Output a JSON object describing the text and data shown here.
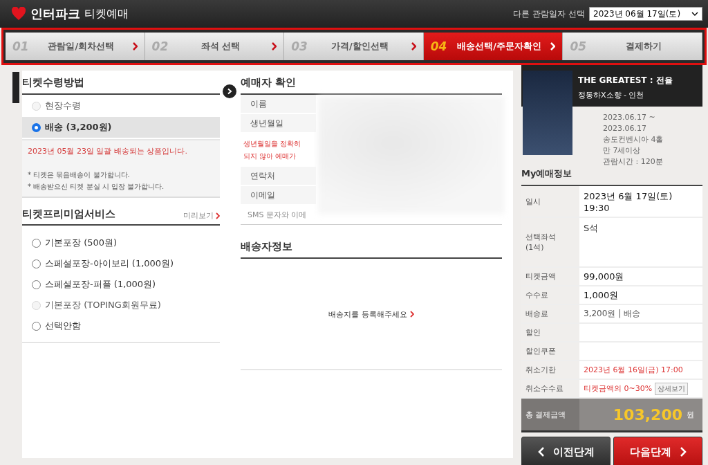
{
  "header": {
    "brand": "인터파크",
    "title": "티켓예매",
    "date_label": "다른 관람일자 선택",
    "date_select": "2023년 06월 17일(토)"
  },
  "steps": [
    {
      "number": "01",
      "label": "관람일/회차선택",
      "selected": false
    },
    {
      "number": "02",
      "label": "좌석 선택",
      "selected": false
    },
    {
      "number": "03",
      "label": "가격/할인선택",
      "selected": false
    },
    {
      "number": "04",
      "label": "배송선택/주문자확인",
      "selected": true
    },
    {
      "number": "05",
      "label": "결제하기",
      "selected": false
    }
  ],
  "receipt": {
    "title": "티켓수령방법",
    "options": [
      {
        "label": "현장수령",
        "selected": false,
        "disabled": true
      },
      {
        "label": "배송 (3,200원)",
        "selected": true,
        "disabled": false
      }
    ],
    "notice": "2023년 05월 23일 일괄 배송되는 상품입니다.",
    "notes": [
      "* 티켓은 묶음배송이 불가합니다.",
      "* 배송받으신 티켓 분실 시 입장 불가합니다."
    ]
  },
  "premium": {
    "title": "티켓프리미엄서비스",
    "preview_link": "미리보기",
    "options": [
      {
        "label": "기본포장 (500원)",
        "selected": false,
        "disabled": false
      },
      {
        "label": "스페셜포장-아이보리 (1,000원)",
        "selected": false,
        "disabled": false
      },
      {
        "label": "스페셜포장-퍼플 (1,000원)",
        "selected": false,
        "disabled": false
      },
      {
        "label": "기본포장 (TOPING회원무료)",
        "selected": false,
        "disabled": true
      },
      {
        "label": "선택안함",
        "selected": false,
        "disabled": false
      }
    ]
  },
  "buyer": {
    "title": "예매자 확인",
    "rows": [
      {
        "kind": "field",
        "label": "이름"
      },
      {
        "kind": "field",
        "label": "생년월일"
      },
      {
        "kind": "warning",
        "lines": [
          "생년월일을 정확히",
          "되지 않아 예매가"
        ]
      },
      {
        "kind": "field",
        "label": "연락처"
      },
      {
        "kind": "field",
        "label": "이메일"
      },
      {
        "kind": "note",
        "label": "SMS 문자와 이메"
      }
    ]
  },
  "delivery": {
    "title": "배송자정보",
    "register_link": "배송지를 등록해주세요"
  },
  "show": {
    "title": "THE GREATEST : 전율",
    "subtitle": "정동하X소향 - 인천",
    "details": [
      "2023.06.17 ~",
      "2023.06.17",
      "송도컨벤시아 4홀",
      "만 7세이상",
      "관람시간 : 120분"
    ]
  },
  "my_booking": {
    "title": "My예매정보",
    "rows": [
      {
        "kind": "main",
        "label": "일시",
        "value": "2023년 6월 17일(토) 19:30"
      },
      {
        "kind": "tall",
        "label": "선택좌석 (1석)",
        "value": "S석"
      },
      {
        "kind": "main",
        "label": "티켓금액",
        "value": "99,000원"
      },
      {
        "kind": "main",
        "label": "수수료",
        "value": "1,000원"
      },
      {
        "kind": "muted",
        "label": "배송료",
        "value": "3,200원 | 배송"
      },
      {
        "kind": "muted",
        "label": "할인"
      },
      {
        "kind": "muted",
        "label": "할인쿠폰"
      },
      {
        "kind": "alert",
        "label": "취소기한",
        "value": "2023년 6월 16일(금) 17:00"
      },
      {
        "kind": "alert",
        "label": "취소수수료",
        "value": "티켓금액의 0~30%",
        "button": "상세보기"
      }
    ],
    "total_label": "총 결제금액",
    "total": "103,200",
    "total_unit": "원"
  },
  "buttons": {
    "prev": "이전단계",
    "next": "다음단계"
  }
}
